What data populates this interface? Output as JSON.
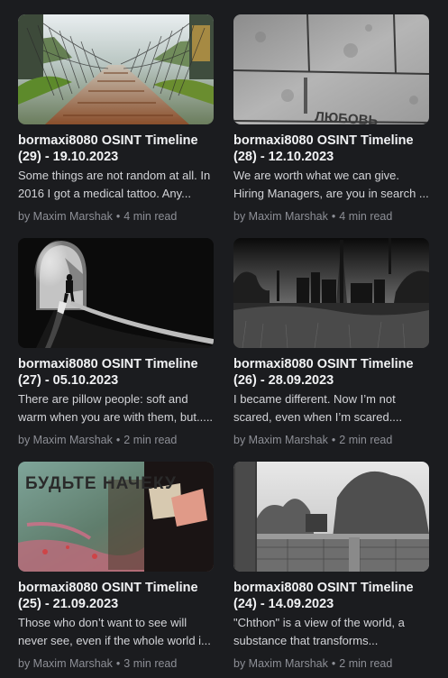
{
  "posts": [
    {
      "title": "bormaxi8080 OSINT Timeline (29) - 19.10.2023",
      "excerpt": "Some things are not random at all. In 2016 I got a medical tattoo. Any...",
      "author": "by Maxim Marshak",
      "read_time": "4 min read",
      "image": "suspension-bridge-photo"
    },
    {
      "title": "bormaxi8080 OSINT Timeline (28) - 12.10.2023",
      "excerpt": "We are worth what we can give. Hiring Managers, are you in search ...",
      "author": "by Maxim Marshak",
      "read_time": "4 min read",
      "image": "concrete-wall-photo",
      "image_text": "ЛЮБОВЬ"
    },
    {
      "title": "bormaxi8080 OSINT Timeline (27) - 05.10.2023",
      "excerpt": "There are pillow people: soft and warm when you are with them, but.....",
      "author": "by Maxim Marshak",
      "read_time": "2 min read",
      "image": "tunnel-photo"
    },
    {
      "title": "bormaxi8080 OSINT Timeline (26) - 28.09.2023",
      "excerpt": "I became different. Now I’m not scared, even when I’m scared....",
      "author": "by Maxim Marshak",
      "read_time": "2 min read",
      "image": "industrial-skyline-photo"
    },
    {
      "title": "bormaxi8080 OSINT Timeline (25) - 21.09.2023",
      "excerpt": "Those who don’t want to see will never see, even if the whole world i...",
      "author": "by Maxim Marshak",
      "read_time": "3 min read",
      "image": "graffiti-wall-photo",
      "image_text": "БУДЬТЕ НАЧЕКУ"
    },
    {
      "title": "bormaxi8080 OSINT Timeline (24) - 14.09.2023",
      "excerpt": "\"Chthon\" is a view of the world, a substance that transforms...",
      "author": "by Maxim Marshak",
      "read_time": "2 min read",
      "image": "brick-fence-photo"
    }
  ]
}
